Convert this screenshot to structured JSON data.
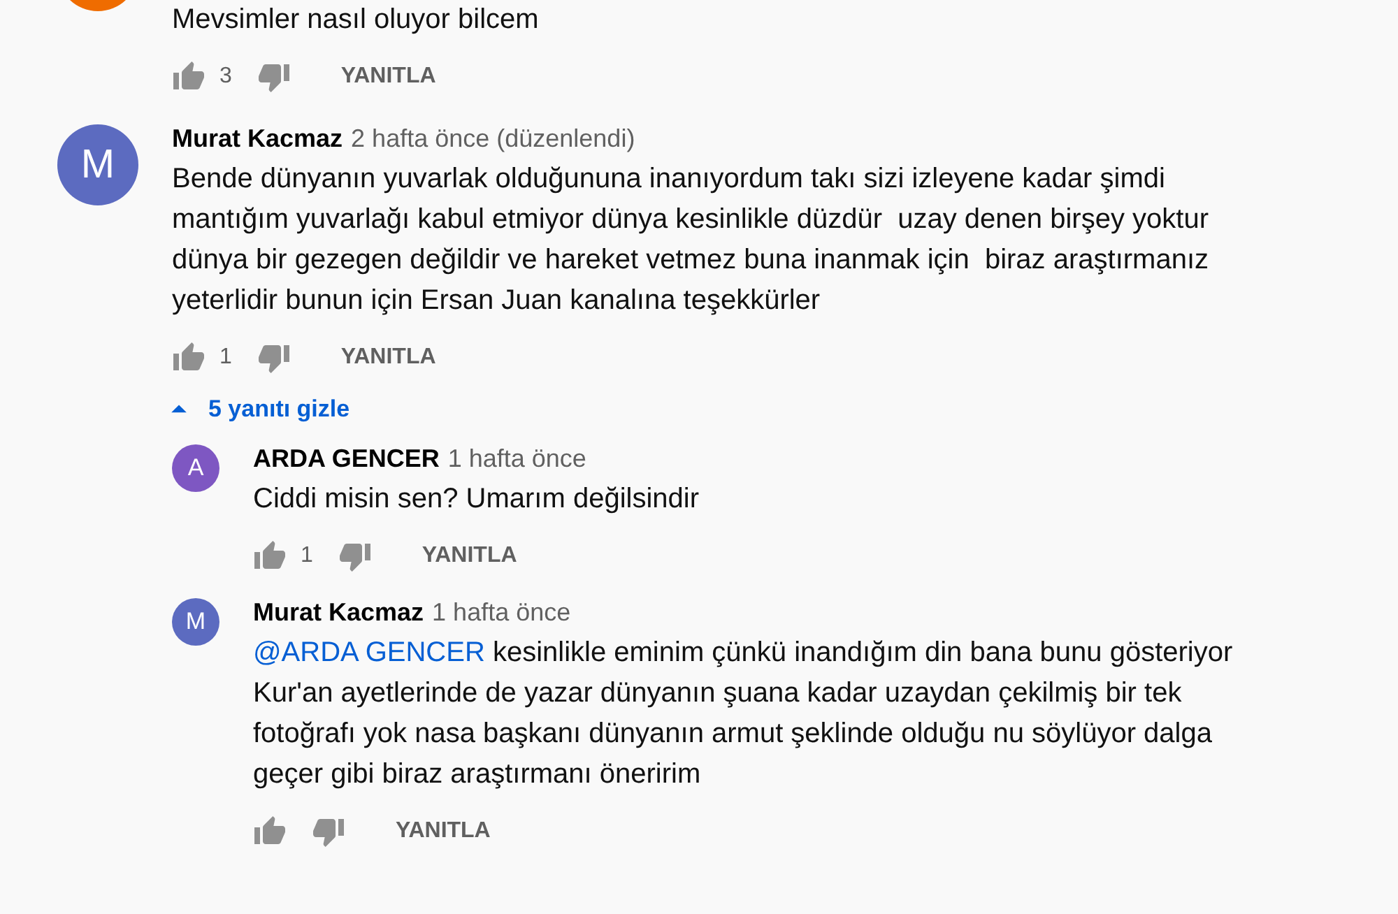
{
  "comments": [
    {
      "avatar": {
        "color": "#ef6c00"
      },
      "text": "Mevsimler nasıl oluyor bilcem",
      "likes": "3",
      "reply_button": "YANITLA"
    },
    {
      "avatar": {
        "letter": "M",
        "color": "#5c6bc0"
      },
      "author": "Murat Kacmaz",
      "time": "2 hafta önce (düzenlendi)",
      "text": "Bende dünyanın yuvarlak olduğununa inanıyordum takı sizi izleyene kadar şimdi mantığım yuvarlağı kabul etmiyor dünya kesinlikle düzdür  uzay denen birşey yoktur dünya bir gezegen değildir ve hareket vetmez buna inanmak için  biraz araştırmanız yeterlidir bunun için Ersan Juan kanalına teşekkürler",
      "likes": "1",
      "reply_button": "YANITLA",
      "replies_toggle": {
        "label": "5 yanıtı gizle",
        "expanded": true
      },
      "replies": [
        {
          "avatar": {
            "letter": "A",
            "color": "#7e57c2"
          },
          "author": "ARDA GENCER",
          "time": "1 hafta önce",
          "text": "Ciddi misin sen? Umarım değilsindir",
          "likes": "1",
          "reply_button": "YANITLA"
        },
        {
          "avatar": {
            "letter": "M",
            "color": "#5c6bc0"
          },
          "author": "Murat Kacmaz",
          "time": "1 hafta önce",
          "mention": "@ARDA GENCER",
          "text": "kesinlikle eminim çünkü inandığım din bana bunu gösteriyor Kur'an ayetlerinde de yazar dünyanın şuana kadar uzaydan çekilmiş bir tek fotoğrafı yok nasa başkanı dünyanın armut şeklinde olduğu nu söylüyor dalga geçer gibi biraz araştırmanı öneririm",
          "reply_button": "YANITLA"
        }
      ]
    }
  ]
}
